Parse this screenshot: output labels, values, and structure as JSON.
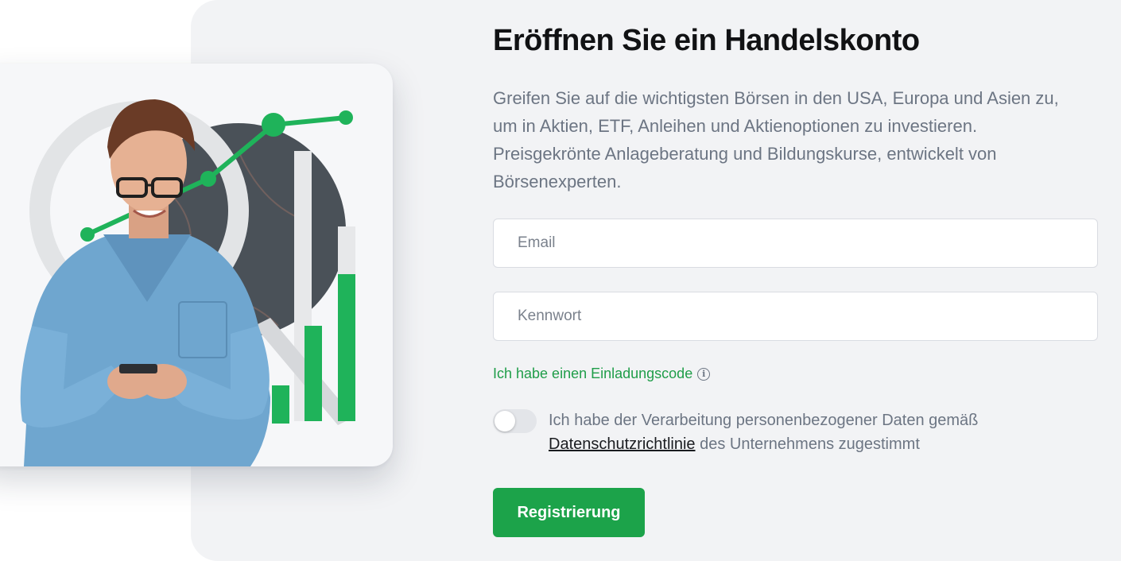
{
  "signup": {
    "title": "Eröffnen Sie ein Handelskonto",
    "description": "Greifen Sie auf die wichtigsten Börsen in den USA, Europa und Asien zu, um in Aktien, ETF, Anleihen und Aktienoptionen zu investieren. Preisgekrönte Anlageberatung und Bildungskurse, entwickelt von Börsenexperten.",
    "email_placeholder": "Email",
    "password_placeholder": "Kennwort",
    "invite_code_label": "Ich habe einen Einladungscode",
    "consent_prefix": "Ich habe der Verarbeitung personenbezogener Daten gemäß",
    "consent_link": "Datenschutzrichtlinie",
    "consent_suffix": " des Unternehmens zugestimmt",
    "consent_toggle_state": "off",
    "register_label": "Registrierung"
  },
  "illustration": {
    "subject": "man-with-smartphone-and-rising-chart",
    "icons": [
      "info-icon"
    ]
  },
  "colors": {
    "accent_green": "#1ca34a",
    "link_green": "#1f9d49",
    "panel_background": "#f2f3f5",
    "text_primary": "#111214",
    "text_secondary": "#6c7583"
  }
}
